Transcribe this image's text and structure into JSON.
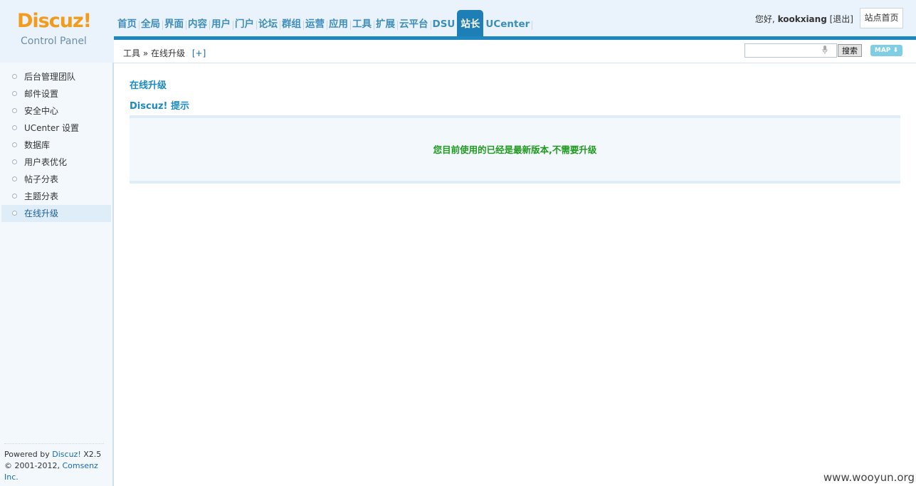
{
  "logo": {
    "brand": "Discuz!",
    "subtitle": "Control Panel"
  },
  "nav": {
    "items": [
      "首页",
      "全局",
      "界面",
      "内容",
      "用户",
      "门户",
      "论坛",
      "群组",
      "运营",
      "应用",
      "工具",
      "扩展",
      "云平台",
      "DSU",
      "站长",
      "UCenter"
    ],
    "active": "站长"
  },
  "user": {
    "greeting": "您好,",
    "username": "kookxiang",
    "logout": "[退出]",
    "site_home": "站点首页"
  },
  "breadcrumb": {
    "section": "工具",
    "separator": "»",
    "page": "在线升级",
    "add": "[+]"
  },
  "search": {
    "value": "",
    "button": "搜索",
    "map_button": "MAP"
  },
  "sidebar": {
    "items": [
      "后台管理团队",
      "邮件设置",
      "安全中心",
      "UCenter 设置",
      "数据库",
      "用户表优化",
      "帖子分表",
      "主题分表",
      "在线升级"
    ],
    "active": "在线升级",
    "footer": {
      "powered_prefix": "Powered by",
      "product": "Discuz!",
      "version": "X2.5",
      "copyright_prefix": "© 2001-2012,",
      "company": "Comsenz Inc."
    }
  },
  "main": {
    "title": "在线升级",
    "tip_title": "Discuz! 提示",
    "message": "您目前使用的已经是最新版本,不需要升级"
  },
  "watermark": "www.wooyun.org",
  "colors": {
    "accent": "#1e87be",
    "link": "#1b8bc4",
    "success": "#1f9a1f",
    "brand_orange": "#f39b1b"
  }
}
